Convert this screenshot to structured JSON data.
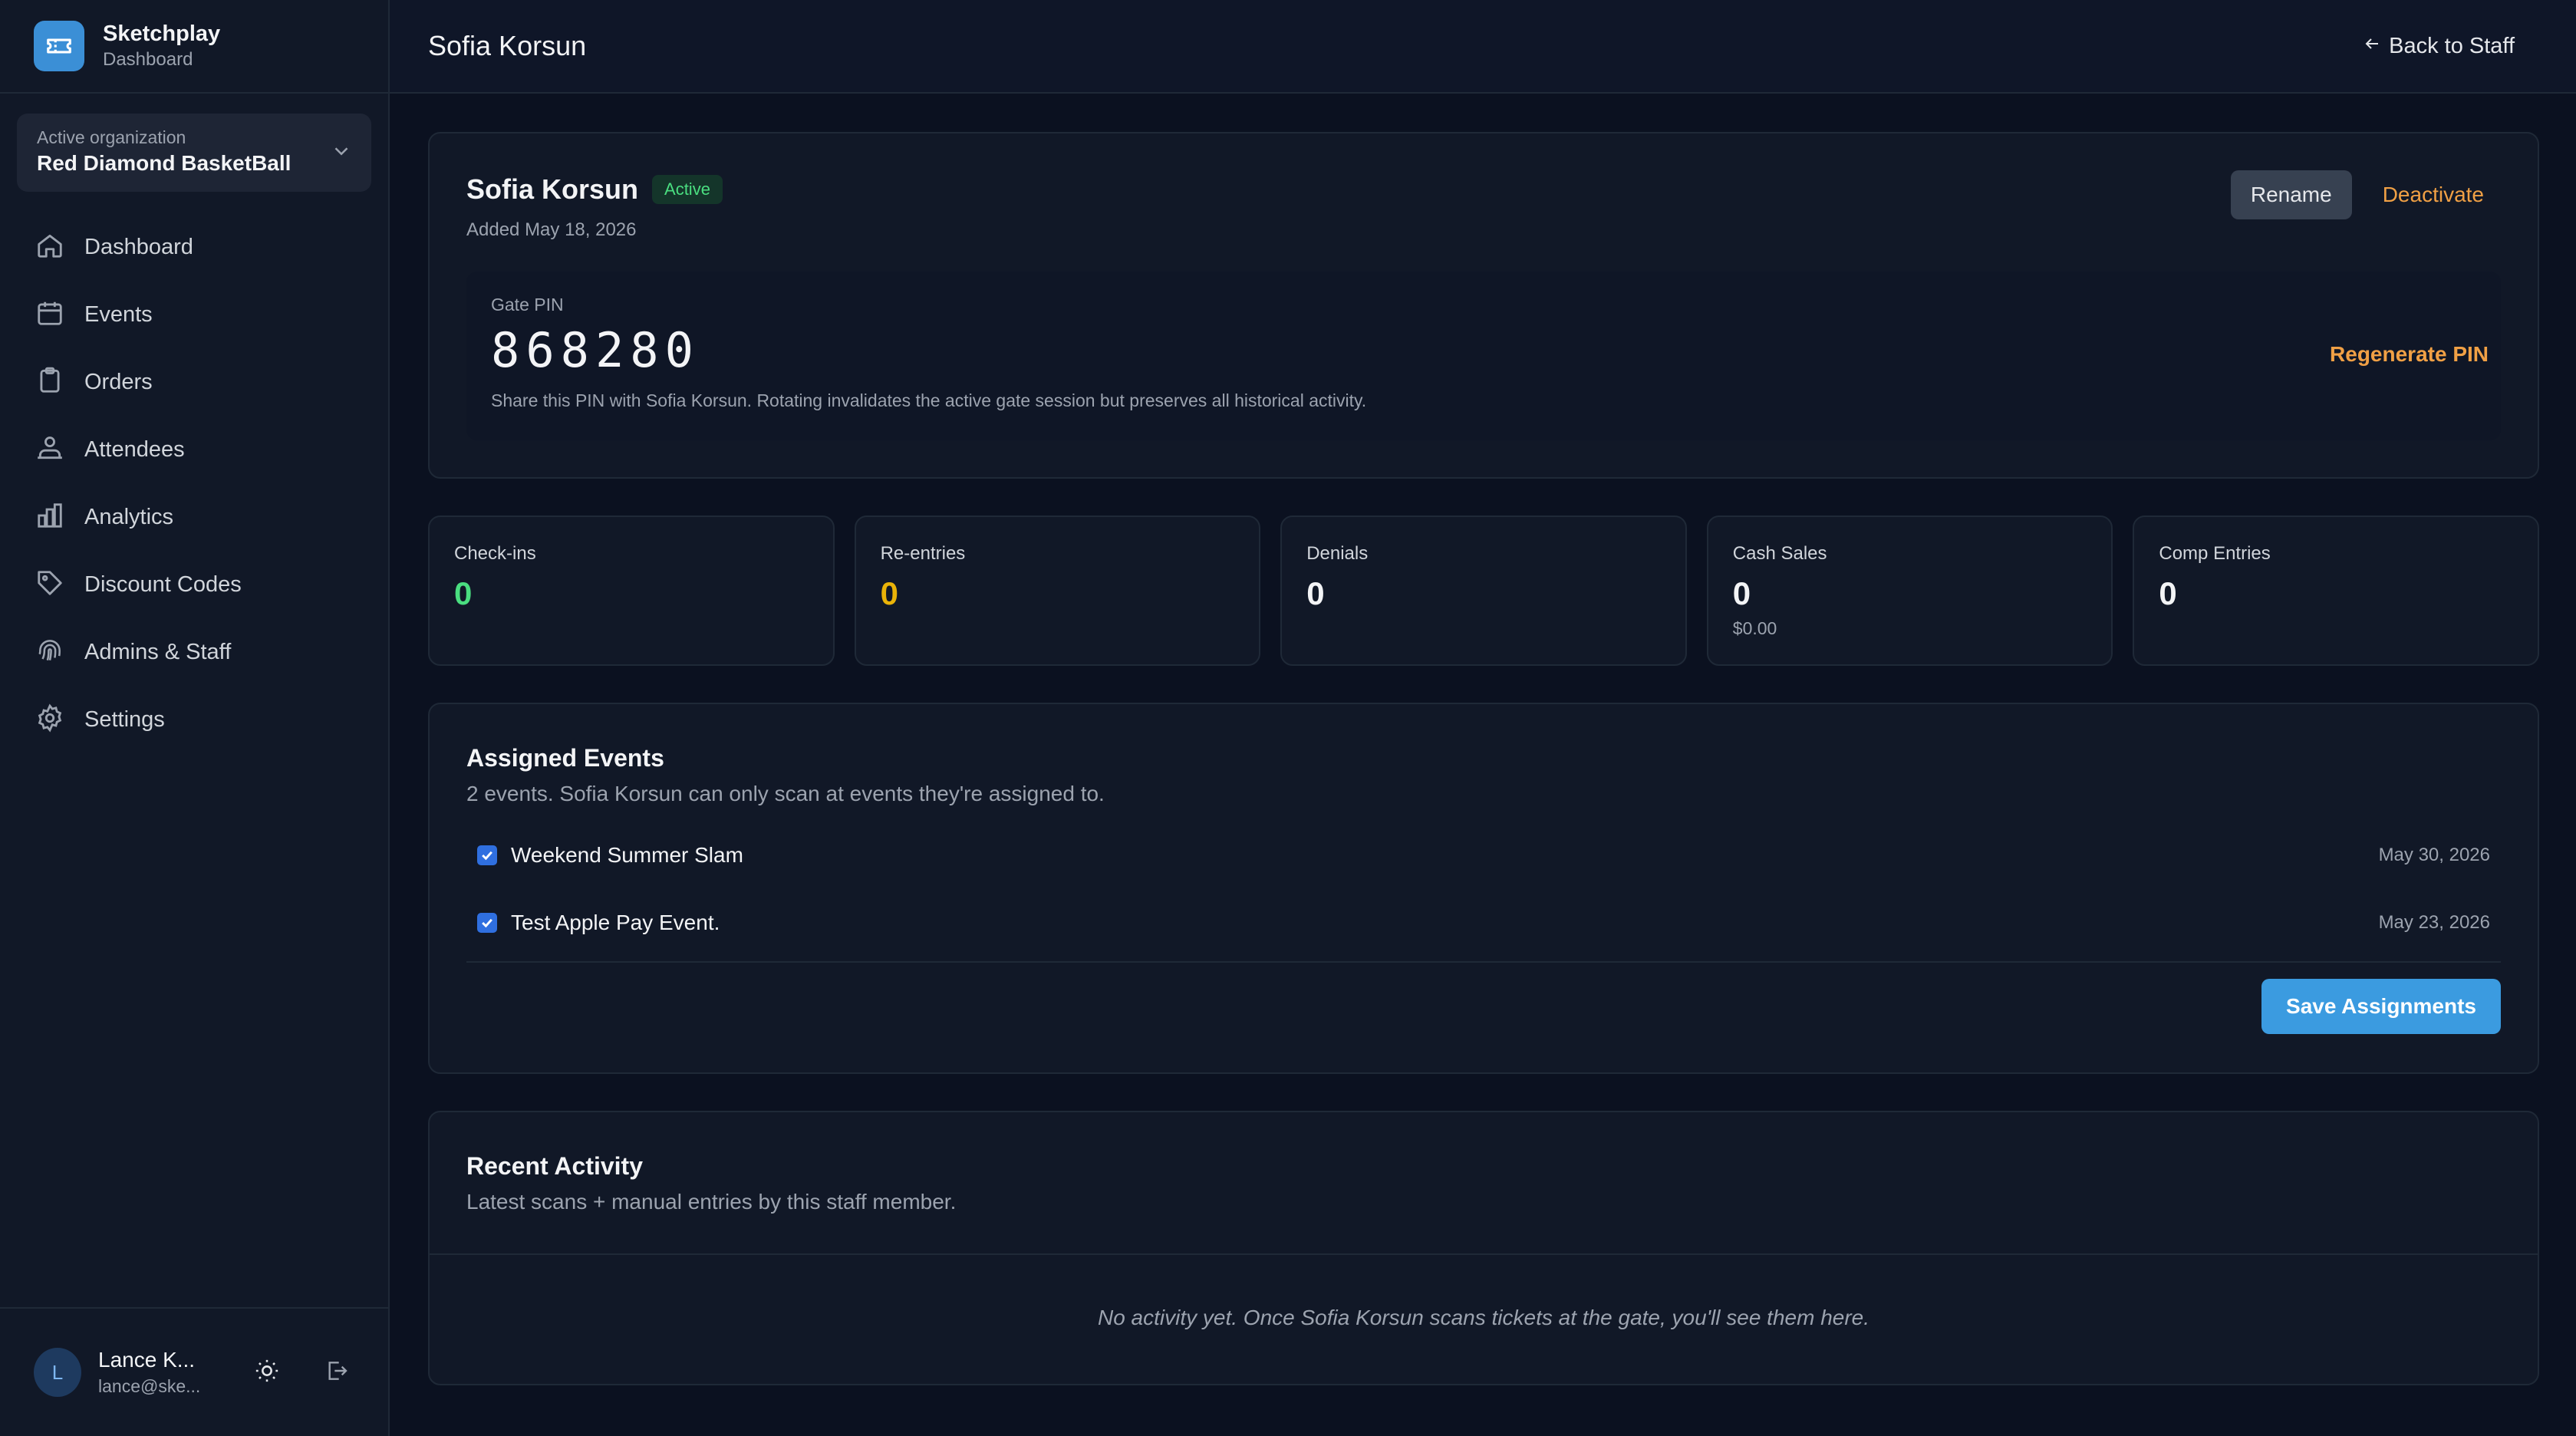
{
  "brand": {
    "name": "Sketchplay",
    "subtitle": "Dashboard"
  },
  "org": {
    "label": "Active organization",
    "name": "Red Diamond BasketBall"
  },
  "nav": [
    {
      "label": "Dashboard",
      "icon": "home-icon"
    },
    {
      "label": "Events",
      "icon": "calendar-icon"
    },
    {
      "label": "Orders",
      "icon": "clipboard-icon"
    },
    {
      "label": "Attendees",
      "icon": "attendees-icon"
    },
    {
      "label": "Analytics",
      "icon": "bar-chart-icon"
    },
    {
      "label": "Discount Codes",
      "icon": "tag-icon"
    },
    {
      "label": "Admins & Staff",
      "icon": "fingerprint-icon"
    },
    {
      "label": "Settings",
      "icon": "gear-icon"
    }
  ],
  "user": {
    "initial": "L",
    "name": "Lance K...",
    "email": "lance@ske..."
  },
  "header": {
    "title": "Sofia Korsun",
    "back_label": "Back to Staff"
  },
  "profile": {
    "name": "Sofia Korsun",
    "status": "Active",
    "added": "Added May 18, 2026",
    "rename_label": "Rename",
    "deactivate_label": "Deactivate"
  },
  "pin": {
    "label": "Gate PIN",
    "value": "868280",
    "help": "Share this PIN with Sofia Korsun. Rotating invalidates the active gate session but preserves all historical activity.",
    "regenerate_label": "Regenerate PIN"
  },
  "stats": [
    {
      "label": "Check-ins",
      "value": "0",
      "color": "#4ade80",
      "sub": ""
    },
    {
      "label": "Re-entries",
      "value": "0",
      "color": "#eab308",
      "sub": ""
    },
    {
      "label": "Denials",
      "value": "0",
      "color": "#f3f4f6",
      "sub": ""
    },
    {
      "label": "Cash Sales",
      "value": "0",
      "color": "#f3f4f6",
      "sub": "$0.00"
    },
    {
      "label": "Comp Entries",
      "value": "0",
      "color": "#f3f4f6",
      "sub": ""
    }
  ],
  "assigned": {
    "title": "Assigned Events",
    "description": "2 events. Sofia Korsun can only scan at events they're assigned to.",
    "events": [
      {
        "name": "Weekend Summer Slam",
        "date": "May 30, 2026",
        "checked": true
      },
      {
        "name": "Test Apple Pay Event.",
        "date": "May 23, 2026",
        "checked": true
      }
    ],
    "save_label": "Save Assignments"
  },
  "activity": {
    "title": "Recent Activity",
    "description": "Latest scans + manual entries by this staff member.",
    "empty": "No activity yet. Once Sofia Korsun scans tickets at the gate, you'll see them here."
  }
}
